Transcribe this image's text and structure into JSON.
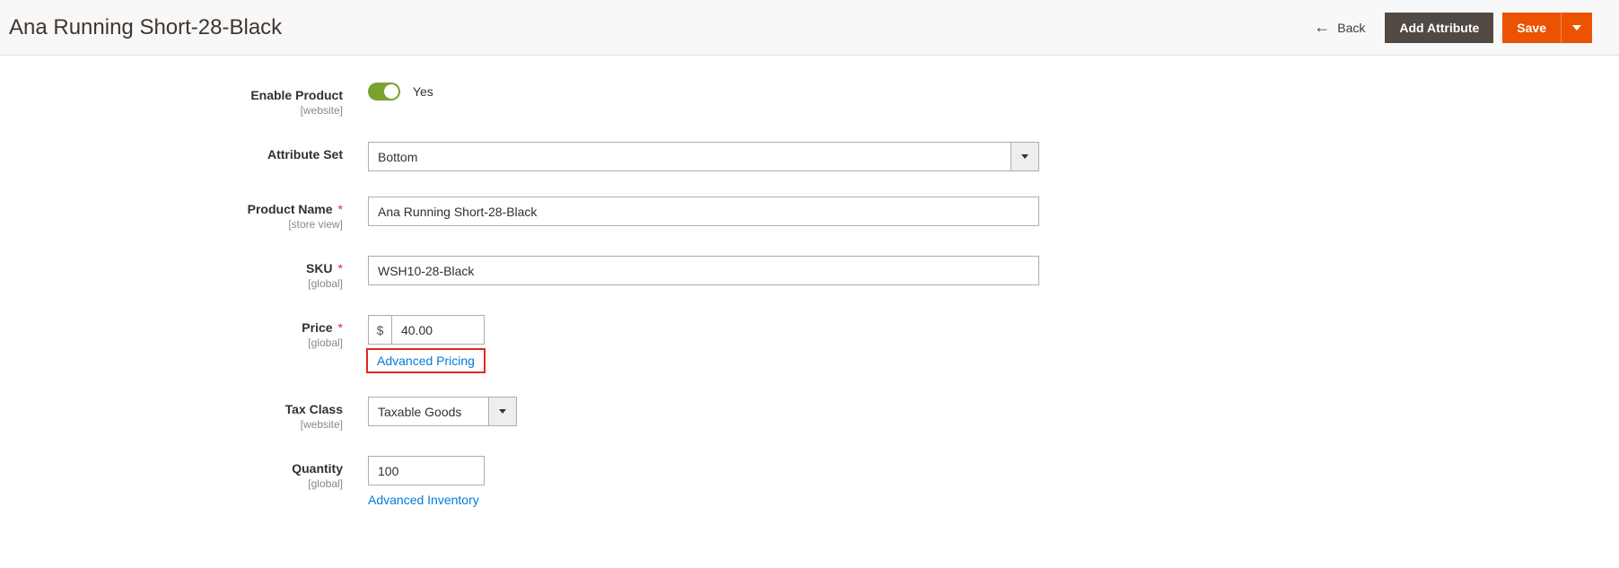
{
  "header": {
    "title": "Ana Running Short-28-Black",
    "back_label": "Back",
    "add_attribute_label": "Add Attribute",
    "save_label": "Save"
  },
  "form": {
    "enable_product": {
      "label": "Enable Product",
      "scope": "[website]",
      "value_label": "Yes"
    },
    "attribute_set": {
      "label": "Attribute Set",
      "value": "Bottom"
    },
    "product_name": {
      "label": "Product Name",
      "scope": "[store view]",
      "value": "Ana Running Short-28-Black"
    },
    "sku": {
      "label": "SKU",
      "scope": "[global]",
      "value": "WSH10-28-Black"
    },
    "price": {
      "label": "Price",
      "scope": "[global]",
      "currency": "$",
      "value": "40.00",
      "advanced_link": "Advanced Pricing"
    },
    "tax_class": {
      "label": "Tax Class",
      "scope": "[website]",
      "value": "Taxable Goods"
    },
    "quantity": {
      "label": "Quantity",
      "scope": "[global]",
      "value": "100",
      "advanced_link": "Advanced Inventory"
    }
  }
}
